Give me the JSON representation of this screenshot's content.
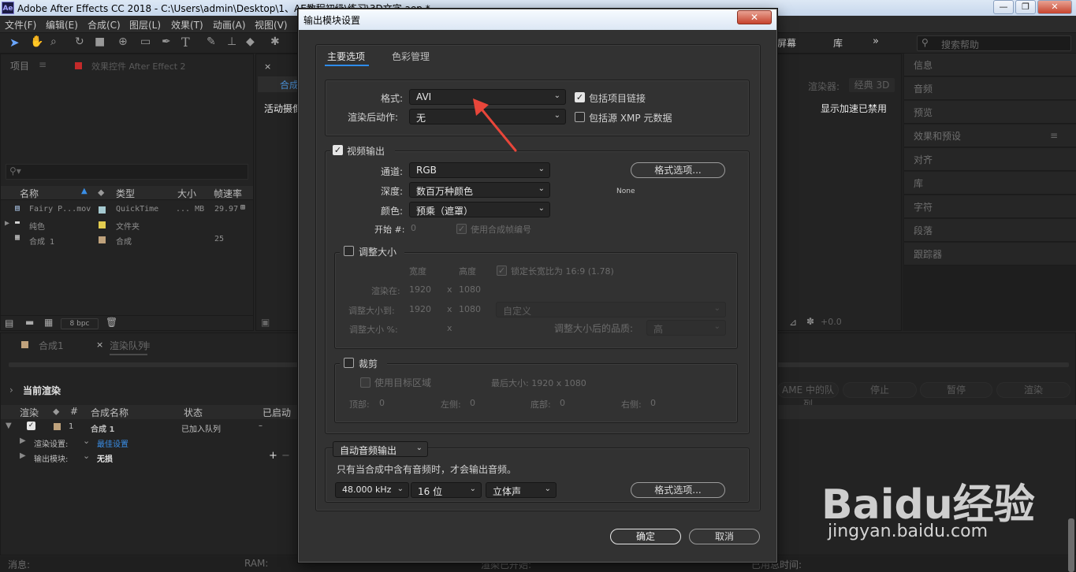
{
  "window": {
    "app_logo": "Ae",
    "title": "Adobe After Effects CC 2018 - C:\\Users\\admin\\Desktop\\1、AE教程初级\\练习\\3D文字.aep *",
    "min": "—",
    "max": "❐",
    "close": "✕"
  },
  "menu": [
    "文件(F)",
    "编辑(E)",
    "合成(C)",
    "图层(L)",
    "效果(T)",
    "动画(A)",
    "视图(V)"
  ],
  "toolbar": {
    "workspace": "屏幕",
    "library": "库",
    "more": "»",
    "search_placeholder": "搜索帮助"
  },
  "project_panel": {
    "tab": "项目",
    "effects_tab": "效果控件 After Effect 2",
    "columns": [
      "名称",
      "类型",
      "大小",
      "帧速率"
    ],
    "items": [
      {
        "name": "Fairy P...mov",
        "type": "QuickTime",
        "size": "... MB",
        "fps": "29.97",
        "color": "#a5c9d0"
      },
      {
        "name": "纯色",
        "type": "文件夹",
        "size": "",
        "fps": "",
        "color": "#e2cc4f"
      },
      {
        "name": "合成 1",
        "type": "合成",
        "size": "",
        "fps": "25",
        "color": "#bfa27c"
      }
    ],
    "bpc": "8 bpc"
  },
  "comp_panel": {
    "tab_label": "合成",
    "active_camera": "活动摄像",
    "renderer_label": "渲染器:",
    "renderer_value": "经典 3D",
    "accel": "显示加速已禁用",
    "zoom_val": "+0.0"
  },
  "right_panel": [
    "信息",
    "音频",
    "预览",
    "效果和预设",
    "对齐",
    "库",
    "字符",
    "段落",
    "跟踪器"
  ],
  "timeline": {
    "tabs": [
      "合成1",
      "渲染队列"
    ],
    "current_render": "当前渲染",
    "queue_label": "AME 中的队列",
    "stop": "停止",
    "pause": "暂停",
    "render": "渲染",
    "columns": [
      "渲染",
      "#",
      "合成名称",
      "状态",
      "已启动"
    ],
    "item": {
      "num": "1",
      "name": "合成 1",
      "status": "已加入队列",
      "started": "–"
    },
    "render_settings_label": "渲染设置:",
    "render_settings_value": "最佳设置",
    "output_module_label": "输出模块:",
    "output_module_value": "无损"
  },
  "status_bar": {
    "messages": "消息:",
    "ram": "RAM:",
    "render_started": "渲染已开始:",
    "elapsed": "已用总时间:"
  },
  "dialog": {
    "title": "输出模块设置",
    "close": "✕",
    "tabs": [
      "主要选项",
      "色彩管理"
    ],
    "format_label": "格式:",
    "format_value": "AVI",
    "post_render_label": "渲染后动作:",
    "post_render_value": "无",
    "include_project_link": "包括项目链接",
    "include_xmp": "包括源 XMP 元数据",
    "video_output": "视频输出",
    "channels_label": "通道:",
    "channels_value": "RGB",
    "depth_label": "深度:",
    "depth_value": "数百万种颜色",
    "color_label": "颜色:",
    "color_value": "预乘（遮罩）",
    "start_label": "开始 #:",
    "start_value": "0",
    "use_comp_frame": "使用合成帧编号",
    "format_options": "格式选项...",
    "codec_info": "None",
    "resize": "调整大小",
    "width": "宽度",
    "height": "高度",
    "lock_aspect": "锁定长宽比为 16:9 (1.78)",
    "rendering_at": "渲染在:",
    "render_w": "1920",
    "render_h": "1080",
    "resize_to": "调整大小到:",
    "resize_w": "1920",
    "resize_h": "1080",
    "resize_preset": "自定义",
    "resize_pct": "调整大小 %:",
    "x": "x",
    "resize_quality_label": "调整大小后的品质:",
    "resize_quality_value": "高",
    "crop": "裁剪",
    "use_roi": "使用目标区域",
    "final_size": "最后大小: 1920 x 1080",
    "top": "顶部:",
    "top_v": "0",
    "left": "左侧:",
    "left_v": "0",
    "bottom": "底部:",
    "bottom_v": "0",
    "right": "右侧:",
    "right_v": "0",
    "audio_mode": "自动音频输出",
    "audio_note": "只有当合成中含有音频时，才会输出音频。",
    "sample_rate": "48.000 kHz",
    "bit_depth": "16 位",
    "channels_audio": "立体声",
    "audio_format_options": "格式选项...",
    "ok": "确定",
    "cancel": "取消"
  },
  "watermark": {
    "brand": "Baidu经验",
    "url": "jingyan.baidu.com"
  },
  "colors": {
    "annotation_arrow": "#e8463a",
    "accent_blue": "#2d8ceb"
  }
}
